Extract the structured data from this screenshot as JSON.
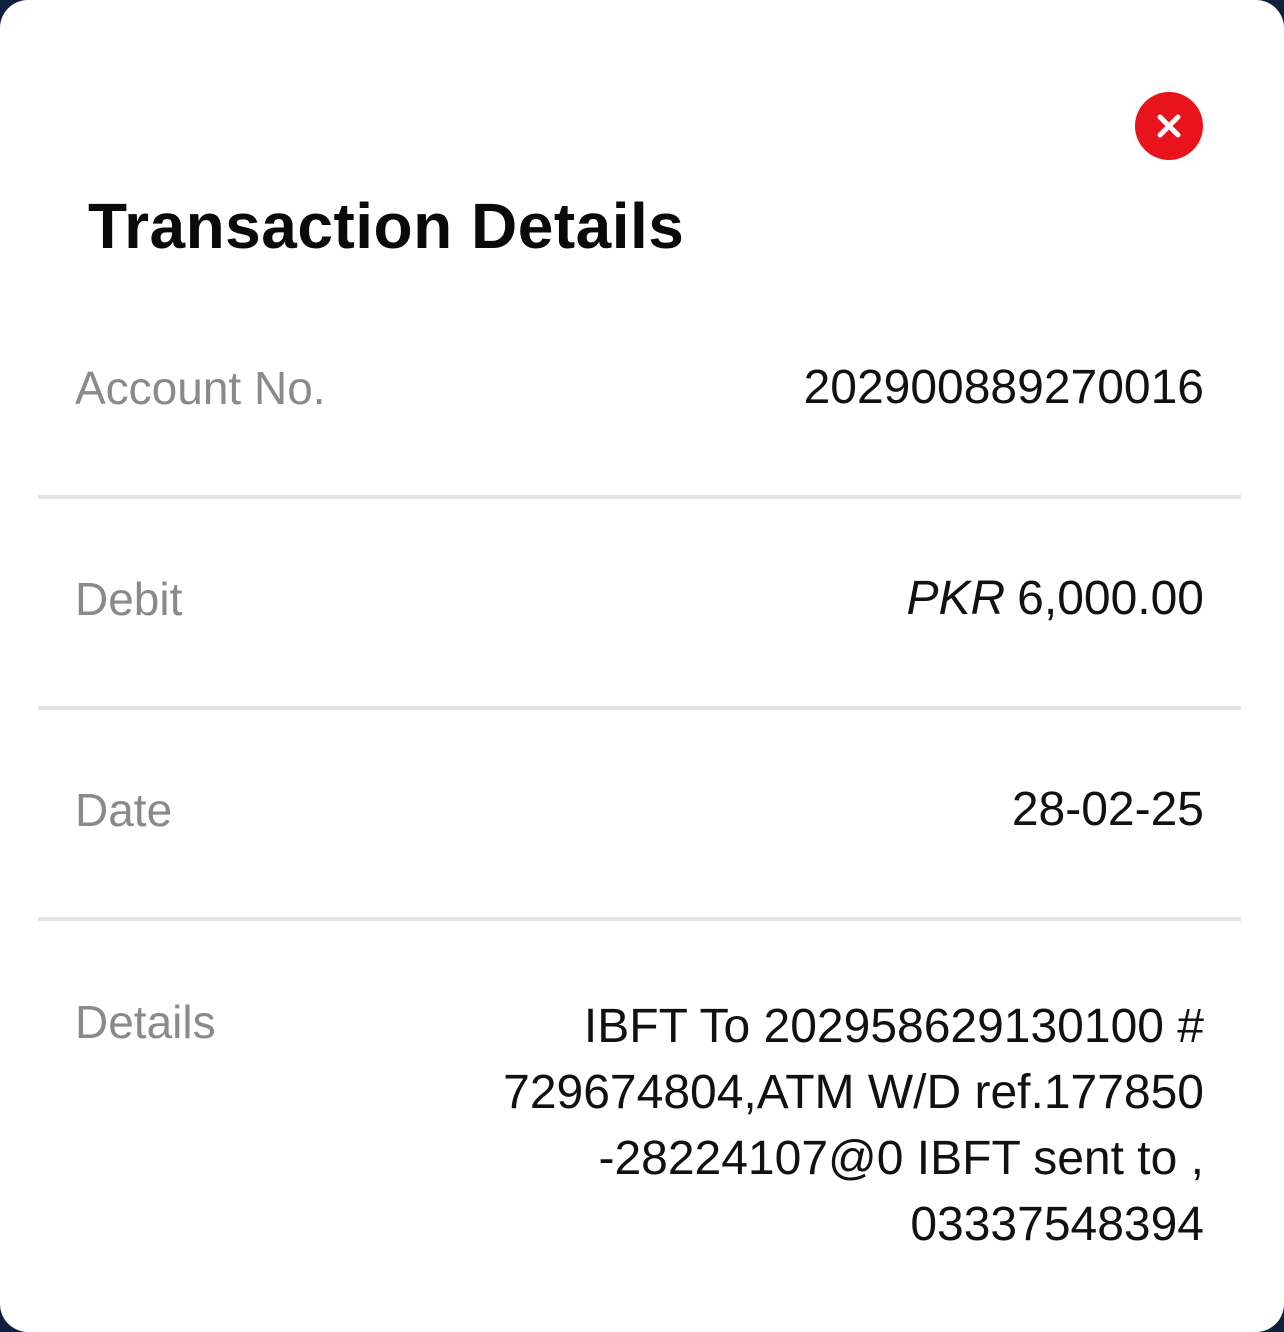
{
  "dialog": {
    "title": "Transaction Details",
    "close_icon": "close-icon"
  },
  "fields": {
    "account": {
      "label": "Account No.",
      "value": "202900889270016"
    },
    "debit": {
      "label": "Debit",
      "currency": "PKR",
      "amount": "6,000.00"
    },
    "date": {
      "label": "Date",
      "value": "28-02-25"
    },
    "details": {
      "label": "Details",
      "lines": [
        "IBFT To 202958629130100 #",
        "729674804,ATM W/D ref.177850",
        "-28224107@0 IBFT sent to ,",
        "03337548394"
      ]
    }
  },
  "colors": {
    "close_button": "#e8131b",
    "label": "#8a8a8a",
    "value": "#111111",
    "divider": "#e3e3e3"
  }
}
